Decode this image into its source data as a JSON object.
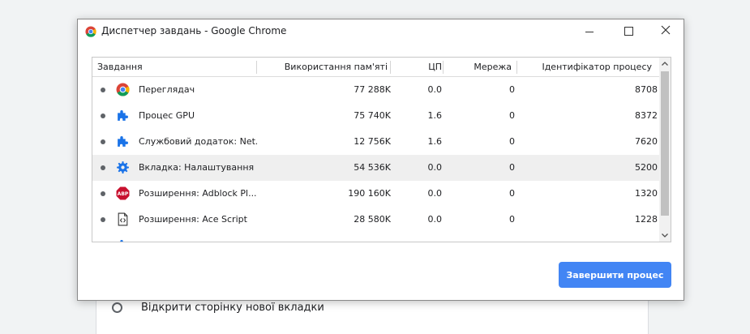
{
  "background": {
    "option_label": "Відкрити сторінку нової вкладки"
  },
  "window": {
    "title": "Диспетчер завдань - Google Chrome",
    "app_icon": "chrome-logo-icon",
    "controls": [
      "minimize-icon",
      "maximize-icon",
      "close-icon"
    ]
  },
  "table": {
    "headers": {
      "task": "Завдання",
      "memory": "Використання пам'яті",
      "cpu": "ЦП",
      "network": "Мережа",
      "pid": "Ідентифікатор процесу"
    },
    "rows": [
      {
        "icon": "chrome-icon",
        "task": "Переглядач",
        "memory": "77 288K",
        "cpu": "0.0",
        "network": "0",
        "pid": "8708"
      },
      {
        "icon": "puzzle-icon",
        "task": "Процес GPU",
        "memory": "75 740K",
        "cpu": "1.6",
        "network": "0",
        "pid": "8372"
      },
      {
        "icon": "puzzle-icon",
        "task": "Службовий додаток: Net...",
        "memory": "12 756K",
        "cpu": "1.6",
        "network": "0",
        "pid": "7620"
      },
      {
        "icon": "gear-icon",
        "task": "Вкладка: Налаштування",
        "memory": "54 536K",
        "cpu": "0.0",
        "network": "0",
        "pid": "5200"
      },
      {
        "icon": "adblock-icon",
        "task": "Розширення: Adblock Pl...",
        "memory": "190 160K",
        "cpu": "0.0",
        "network": "0",
        "pid": "1320"
      },
      {
        "icon": "script-icon",
        "task": "Розширення: Ace Script",
        "memory": "28 580K",
        "cpu": "0.0",
        "network": "0",
        "pid": "1228"
      }
    ],
    "selected_row_index": 3,
    "abp_badge": "ABP"
  },
  "actions": {
    "end_process": "Завершити процес"
  },
  "colors": {
    "accent": "#4285f4",
    "selected_row": "#efefef",
    "adblock_red": "#c8102e"
  }
}
